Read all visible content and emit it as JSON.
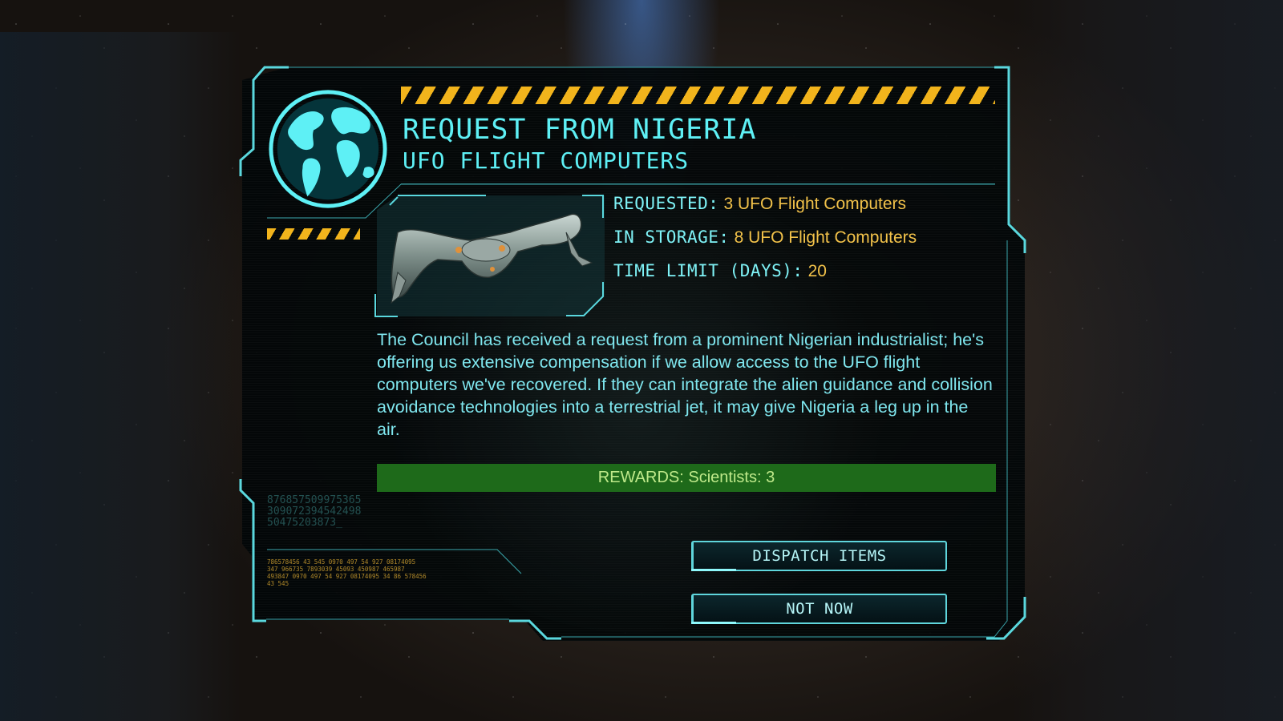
{
  "dialog": {
    "title": "REQUEST FROM NIGERIA",
    "subtitle": "UFO FLIGHT COMPUTERS",
    "item_icon": "ufo-flight-computer-image"
  },
  "stats": {
    "requested_label": "REQUESTED:",
    "requested_value": "3 UFO Flight Computers",
    "storage_label": "IN STORAGE:",
    "storage_value": "8 UFO Flight Computers",
    "time_label": "TIME LIMIT (DAYS):",
    "time_value": "20"
  },
  "description": "The Council has received a request from a prominent Nigerian industrialist; he's offering us extensive compensation if we allow access to the UFO flight computers we've recovered. If they can integrate the alien guidance and collision avoidance technologies into a terrestrial jet, it may give Nigeria a leg up in the air.",
  "rewards": "REWARDS: Scientists: 3",
  "decor": {
    "numbers_big": "87685750997536530907239454249850475203873_",
    "numbers_small": "786578456 43 545 0970 497 54 927 08174095 347 966735 7893039 45093 450987 465987 493847 0970 497 54 927 08174095 34 86 578456 43 545"
  },
  "buttons": {
    "dispatch": "DISPATCH ITEMS",
    "not_now": "NOT NOW"
  },
  "colors": {
    "cyan": "#5ef0f5",
    "gold": "#f2c24a",
    "hazard": "#f2b41c",
    "reward_bg": "#1e6a1a",
    "reward_text": "#bfe98a"
  }
}
